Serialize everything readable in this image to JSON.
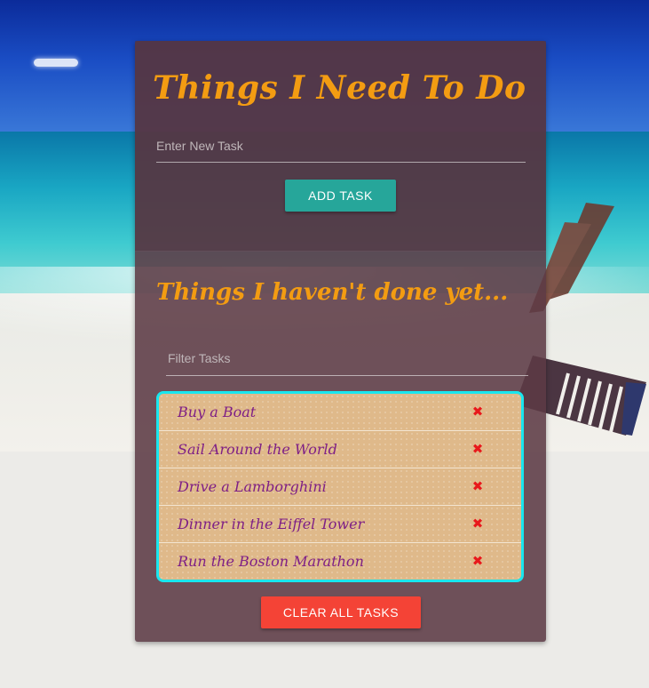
{
  "header": {
    "title": "Things I Need To Do"
  },
  "new_task": {
    "placeholder": "Enter New Task",
    "value": "",
    "add_label": "ADD TASK"
  },
  "pending": {
    "heading": "Things I haven't done yet...",
    "filter_placeholder": "Filter Tasks",
    "filter_value": ""
  },
  "tasks": [
    {
      "label": "Buy a Boat",
      "delete_icon": "close-icon"
    },
    {
      "label": "Sail Around the World",
      "delete_icon": "close-icon"
    },
    {
      "label": "Drive a Lamborghini",
      "delete_icon": "close-icon"
    },
    {
      "label": "Dinner in the Eiffel Tower",
      "delete_icon": "close-icon"
    },
    {
      "label": "Run the Boston Marathon",
      "delete_icon": "close-icon"
    }
  ],
  "footer": {
    "clear_label": "CLEAR ALL TASKS"
  },
  "colors": {
    "accent_orange": "#f39c12",
    "add_button": "#26a69a",
    "clear_button": "#f44336",
    "task_text": "#7e1f86",
    "list_border": "#19e6ee",
    "delete": "#e8191c"
  }
}
